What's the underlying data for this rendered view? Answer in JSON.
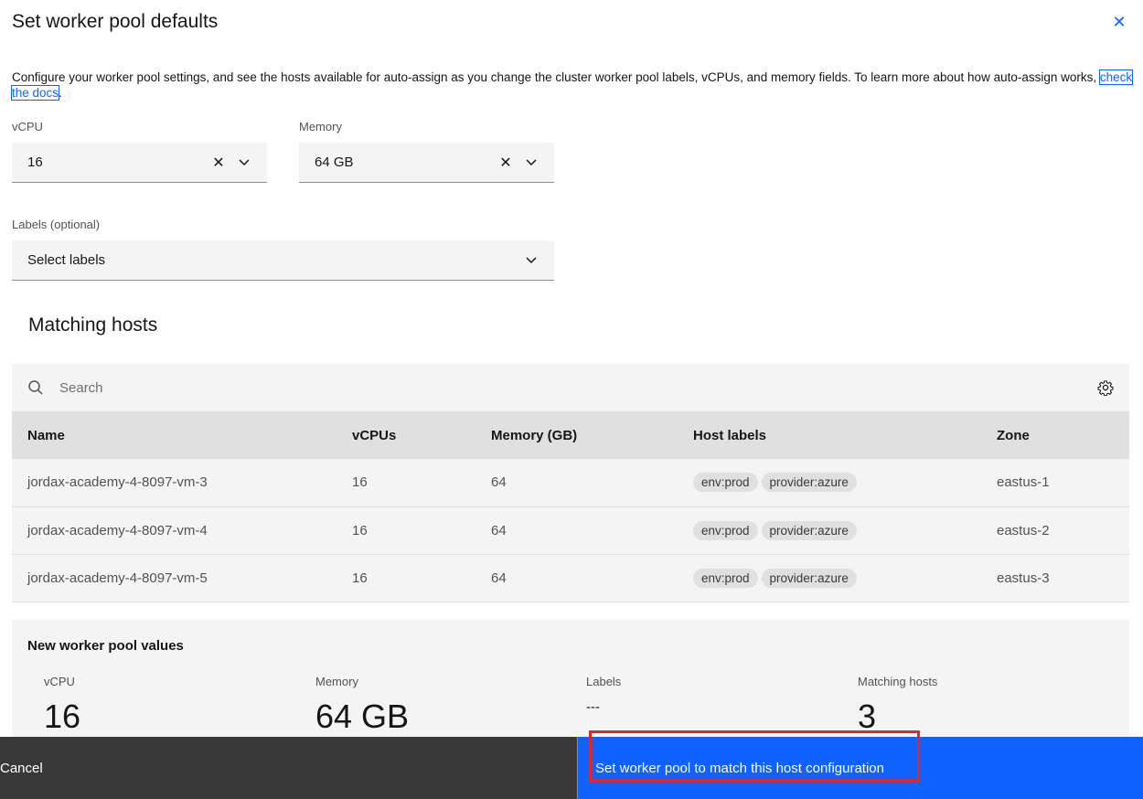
{
  "modal": {
    "title": "Set worker pool defaults",
    "intro_text": "Configure your worker pool settings, and see the hosts available for auto-assign as you change the cluster worker pool labels, vCPUs, and memory fields. To learn more about how auto-assign works, ",
    "docs_link": "check the docs",
    "intro_end": "."
  },
  "form": {
    "vcpu": {
      "label": "vCPU",
      "value": "16"
    },
    "memory": {
      "label": "Memory",
      "value": "64 GB"
    },
    "labels": {
      "label": "Labels (optional)",
      "value": "Select labels"
    }
  },
  "matching": {
    "title": "Matching hosts",
    "search_placeholder": "Search",
    "columns": [
      "Name",
      "vCPUs",
      "Memory (GB)",
      "Host labels",
      "Zone"
    ],
    "rows": [
      {
        "name": "jordax-academy-4-8097-vm-3",
        "vcpus": "16",
        "memory": "64",
        "labels": [
          "env:prod",
          "provider:azure"
        ],
        "zone": "eastus-1"
      },
      {
        "name": "jordax-academy-4-8097-vm-4",
        "vcpus": "16",
        "memory": "64",
        "labels": [
          "env:prod",
          "provider:azure"
        ],
        "zone": "eastus-2"
      },
      {
        "name": "jordax-academy-4-8097-vm-5",
        "vcpus": "16",
        "memory": "64",
        "labels": [
          "env:prod",
          "provider:azure"
        ],
        "zone": "eastus-3"
      }
    ]
  },
  "summary": {
    "title": "New worker pool values",
    "vcpu": {
      "label": "vCPU",
      "value": "16"
    },
    "memory": {
      "label": "Memory",
      "value": "64 GB"
    },
    "labels": {
      "label": "Labels",
      "value": "---"
    },
    "hosts": {
      "label": "Matching hosts",
      "value": "3"
    }
  },
  "footer": {
    "cancel_label": "Cancel",
    "primary_label": "Set worker pool to match this host configuration"
  },
  "colors": {
    "primary": "#0f62fe",
    "secondary": "#393939",
    "highlight": "#e0262a"
  }
}
